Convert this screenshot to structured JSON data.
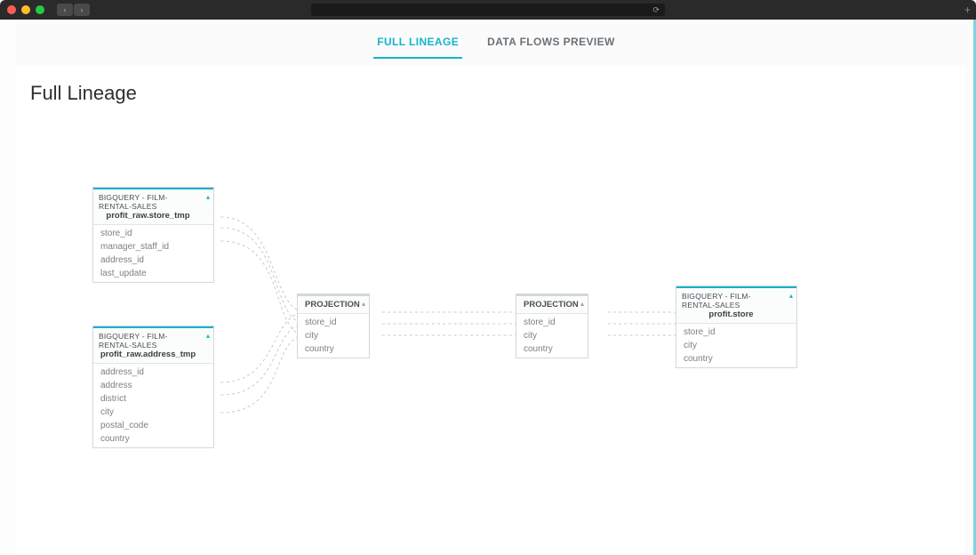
{
  "tabs": {
    "full_lineage": "FULL LINEAGE",
    "data_flows_preview": "DATA FLOWS PREVIEW"
  },
  "page_title": "Full Lineage",
  "nodes": {
    "store_tmp": {
      "source": "BIGQUERY - FILM-RENTAL-SALES",
      "name": "profit_raw.store_tmp",
      "fields": [
        "store_id",
        "manager_staff_id",
        "address_id",
        "last_update"
      ]
    },
    "address_tmp": {
      "source": "BIGQUERY - FILM-RENTAL-SALES",
      "name": "profit_raw.address_tmp",
      "fields": [
        "address_id",
        "address",
        "district",
        "city",
        "postal_code",
        "country"
      ]
    },
    "projection1": {
      "name": "PROJECTION",
      "fields": [
        "store_id",
        "city",
        "country"
      ]
    },
    "projection2": {
      "name": "PROJECTION",
      "fields": [
        "store_id",
        "city",
        "country"
      ]
    },
    "profit_store": {
      "source": "BIGQUERY - FILM-RENTAL-SALES",
      "name": "profit.store",
      "fields": [
        "store_id",
        "city",
        "country"
      ]
    }
  }
}
